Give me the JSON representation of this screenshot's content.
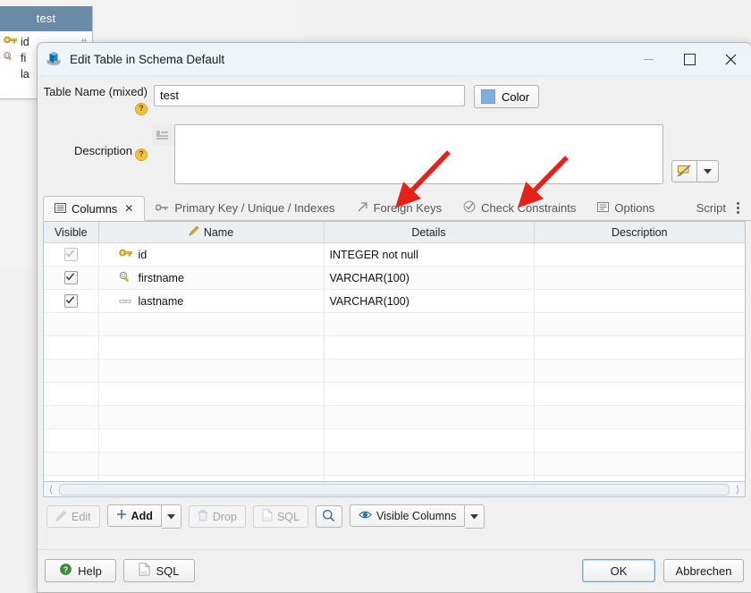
{
  "background": {
    "table_name": "test",
    "hash_mark": "#",
    "rows": [
      {
        "icon": "gold-key-icon",
        "label": "id"
      },
      {
        "icon": "gray-key-unique-icon",
        "label": "fi"
      },
      {
        "icon": "none",
        "label": "la"
      }
    ]
  },
  "dialog": {
    "title": "Edit Table in Schema Default",
    "icon": "database-table-icon",
    "window_controls": {
      "minimize": "–",
      "maximize": "□",
      "close": "✕"
    },
    "form": {
      "table_name_label": "Table Name (mixed)",
      "table_name_value": "test",
      "table_name_help": "?",
      "color_button": "Color",
      "color_swatch_hex": "#7fb0dd",
      "description_label": "Description",
      "description_help": "?",
      "description_value": "",
      "desc_tool_icon": "format-list-icon",
      "desc_more_icon": "ellipsis-icon",
      "spellcheck_icon": "spellcheck-disabled-icon",
      "spellcheck_dropdown_icon": "caret-down-icon"
    },
    "tabs": [
      {
        "label": "Columns",
        "icon": "columns-icon",
        "active": true,
        "closable": true,
        "close_glyph": "✕"
      },
      {
        "label": "Primary Key / Unique / Indexes",
        "icon": "key-icon",
        "active": false
      },
      {
        "label": "Foreign Keys",
        "icon": "arrow-up-right-icon",
        "active": false
      },
      {
        "label": "Check Constraints",
        "icon": "check-circle-icon",
        "active": false
      },
      {
        "label": "Options",
        "icon": "options-icon",
        "active": false
      },
      {
        "label": "Script",
        "icon": "none",
        "active": false
      }
    ],
    "tab_overflow_icon": "kebab-menu-icon",
    "grid": {
      "columns": [
        "Visible",
        "Name",
        "Details",
        "Description"
      ],
      "name_header_icon": "pencil-icon",
      "rows": [
        {
          "visible": true,
          "visible_dim": true,
          "icon": "gold-key-icon",
          "name": "id",
          "details": "INTEGER not null",
          "description": ""
        },
        {
          "visible": true,
          "visible_dim": false,
          "icon": "gray-key-unique-icon",
          "name": "firstname",
          "details": "VARCHAR(100)",
          "description": ""
        },
        {
          "visible": true,
          "visible_dim": false,
          "icon": "dashes-icon",
          "name": "lastname",
          "details": "VARCHAR(100)",
          "description": ""
        }
      ],
      "empty_row_count": 9
    },
    "hscrollbar": {
      "left_icon": "chevron-left-icon",
      "right_icon": "chevron-right-icon"
    },
    "toolbar": [
      {
        "label": "Edit",
        "icon": "pencil-icon",
        "enabled": false
      },
      {
        "label": "Add",
        "icon": "plus-icon",
        "enabled": true,
        "has_dropdown": true
      },
      {
        "label": "Drop",
        "icon": "trash-icon",
        "enabled": false
      },
      {
        "label": "SQL",
        "icon": "sql-file-icon",
        "enabled": false
      },
      {
        "label": "",
        "icon": "search-icon",
        "enabled": true
      },
      {
        "label": "Visible Columns",
        "icon": "eye-icon",
        "enabled": true,
        "has_dropdown": true
      }
    ],
    "footer": {
      "help_label": "Help",
      "help_icon": "help-circle-icon",
      "sql_label": "SQL",
      "sql_icon": "sql-file-icon",
      "ok_label": "OK",
      "cancel_label": "Abbrechen"
    }
  },
  "annotations": {
    "color": "#e8201a",
    "arrows": [
      {
        "target": "Foreign Keys"
      },
      {
        "target": "Check Constraints"
      }
    ]
  }
}
